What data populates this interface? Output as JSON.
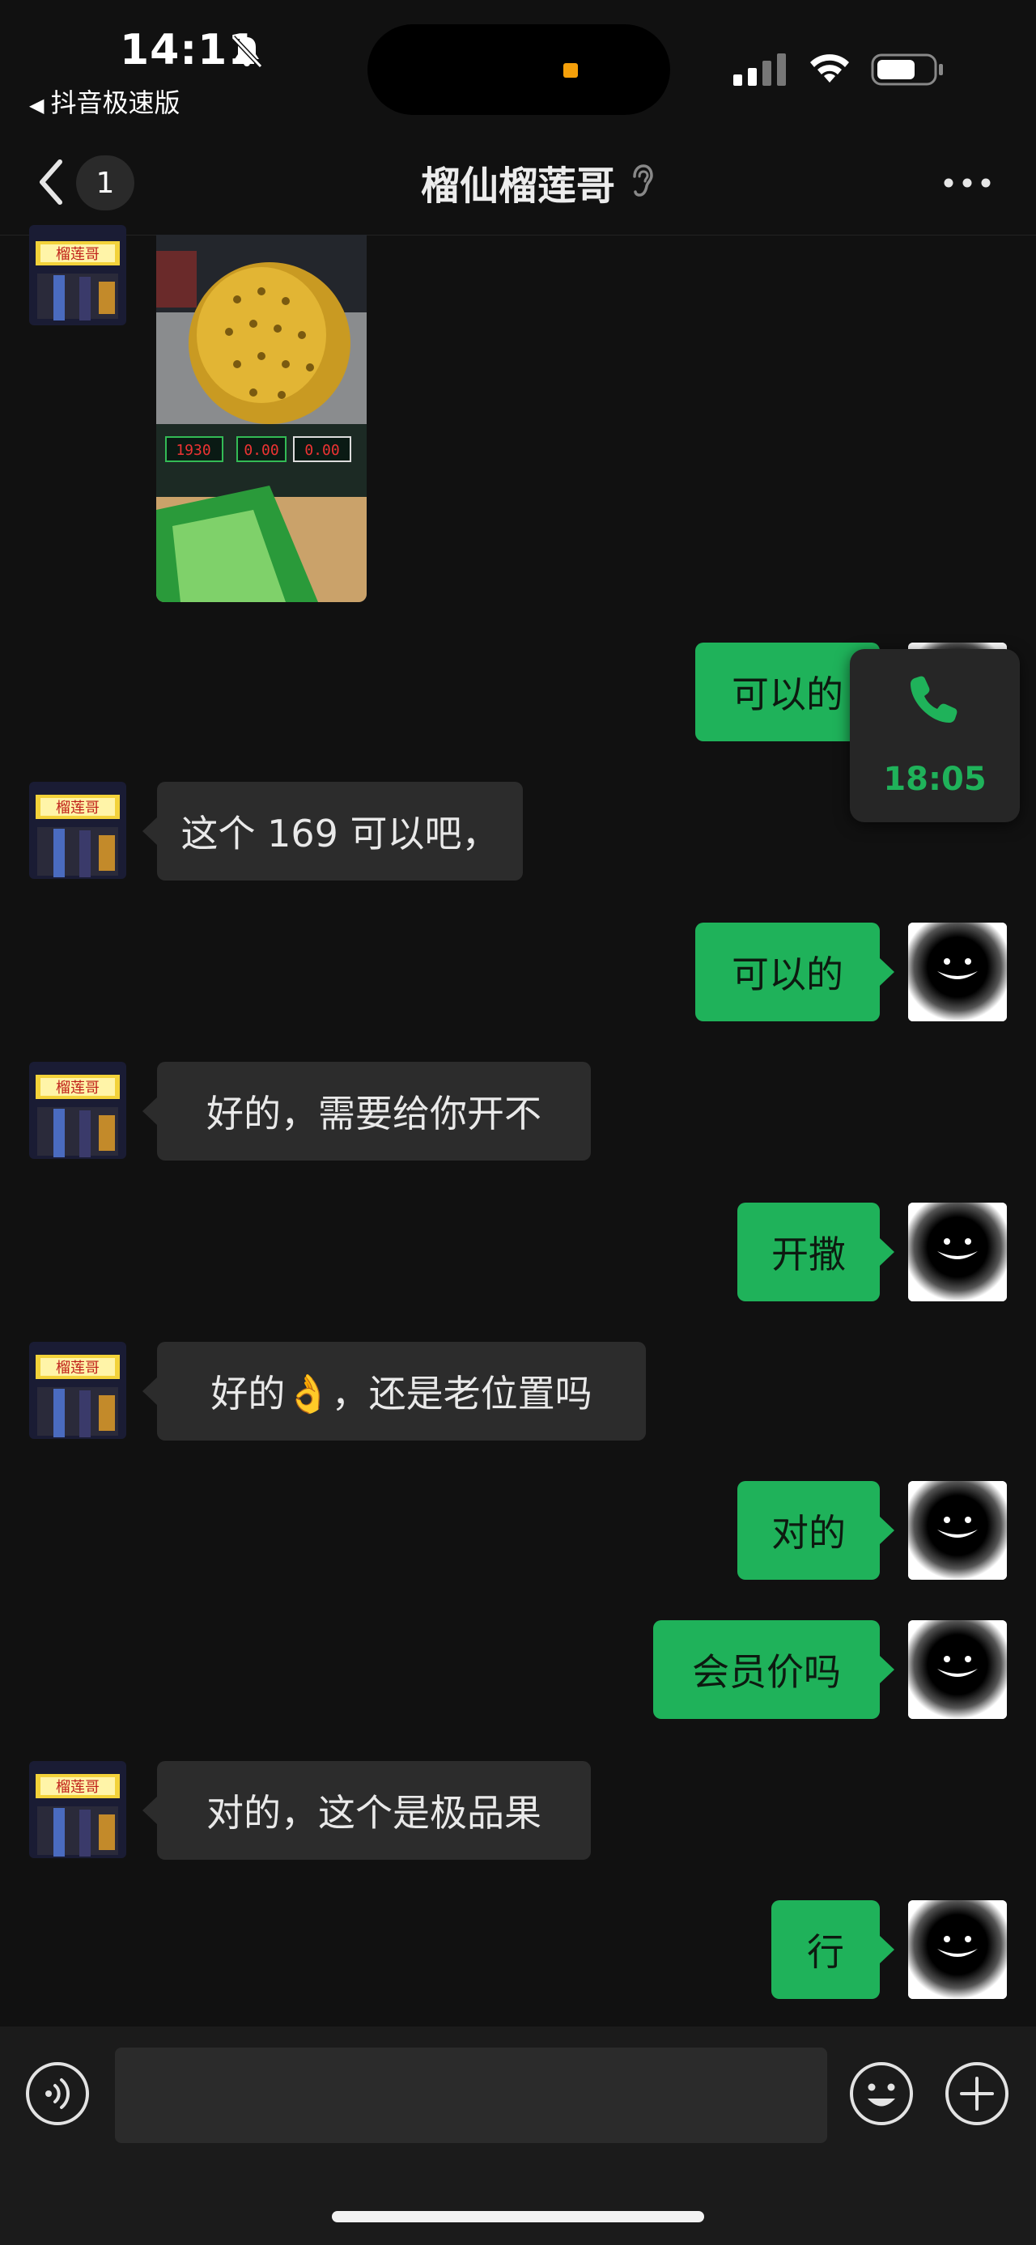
{
  "status_bar": {
    "time": "14:11",
    "back_app_label": "抖音极速版",
    "back_app_glyph": "◀",
    "icons": [
      "bell-slash-icon",
      "signal-icon",
      "wifi-icon",
      "battery-icon"
    ]
  },
  "header": {
    "back_icon": "chevron-left-icon",
    "unread_count": "1",
    "title": "榴仙榴莲哥",
    "title_icon": "ear-icon",
    "more_icon": "more-dots-icon"
  },
  "messages": [
    {
      "side": "in",
      "type": "image",
      "description_icon": "durian-photo"
    },
    {
      "side": "out",
      "text": "可以的"
    },
    {
      "side": "in",
      "text": "这个 169 可以吧，"
    },
    {
      "side": "out",
      "text": "可以的"
    },
    {
      "side": "in",
      "text": "好的，需要给你开不"
    },
    {
      "side": "out",
      "text": "开撒"
    },
    {
      "side": "in",
      "text": "好的👌，还是老位置吗"
    },
    {
      "side": "out",
      "text": "对的"
    },
    {
      "side": "out",
      "text": "会员价吗"
    },
    {
      "side": "in",
      "text": "对的，这个是极品果"
    },
    {
      "side": "out",
      "text": "行"
    }
  ],
  "call_float": {
    "icon": "phone-icon",
    "time": "18:05"
  },
  "input_bar": {
    "voice_icon": "voice-icon",
    "text_value": "",
    "emoji_icon": "emoji-icon",
    "plus_icon": "plus-icon"
  },
  "colors": {
    "background": "#111111",
    "incoming_bubble": "#2c2c2c",
    "outgoing_bubble": "#1fb25a",
    "accent": "#1fb25a"
  }
}
